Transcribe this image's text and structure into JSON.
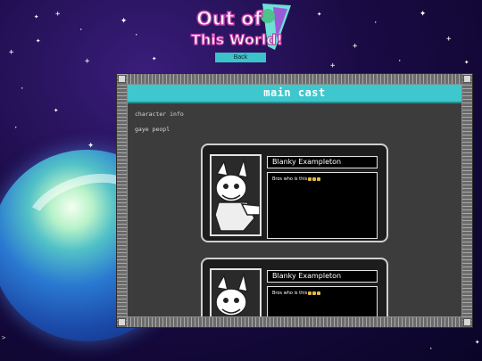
{
  "logo": {
    "line1": "Out of",
    "line2": "This World!"
  },
  "nav": {
    "back_label": "Back"
  },
  "window": {
    "title": "main cast",
    "labels": {
      "section": "character info",
      "subsection": "gaye peopl"
    },
    "cards": [
      {
        "name": "Blanky Exampleton",
        "description": "Bros who is this"
      },
      {
        "name": "Blanky Exampleton",
        "description": "Bros who is this"
      }
    ]
  },
  "colors": {
    "accent": "#3ec7cd",
    "panel": "#3c3c3c",
    "frame": "#8a8a8a",
    "space": "#1a0b45"
  },
  "icons": [
    "sparkle-star-icon",
    "planet-illustration",
    "emoji-icon",
    "cursor-icon"
  ]
}
